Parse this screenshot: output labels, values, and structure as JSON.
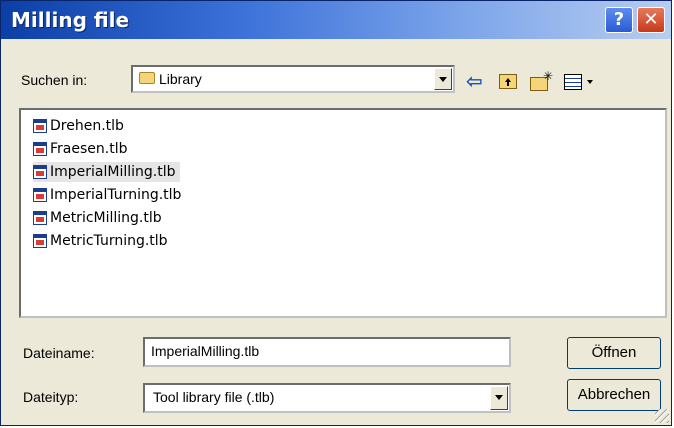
{
  "window": {
    "title": "Milling file"
  },
  "titlebar": {
    "help_glyph": "?",
    "close_glyph": "✕"
  },
  "lookin": {
    "label": "Suchen in:",
    "value": "Library"
  },
  "toolbar": {
    "back_glyph": "⇦"
  },
  "files": [
    {
      "name": "Drehen.tlb",
      "selected": false
    },
    {
      "name": "Fraesen.tlb",
      "selected": false
    },
    {
      "name": "ImperialMilling.tlb",
      "selected": true
    },
    {
      "name": "ImperialTurning.tlb",
      "selected": false
    },
    {
      "name": "MetricMilling.tlb",
      "selected": false
    },
    {
      "name": "MetricTurning.tlb",
      "selected": false
    }
  ],
  "filename": {
    "label": "Dateiname:",
    "value": "ImperialMilling.tlb"
  },
  "filetype": {
    "label": "Dateityp:",
    "value": "Tool library file (.tlb)"
  },
  "buttons": {
    "open": "Öffnen",
    "cancel": "Abbrechen"
  },
  "colors": {
    "titlebar_start": "#0b3fa6",
    "titlebar_end": "#b8cdef",
    "dialog_bg": "#ece9d8",
    "close": "#c7381a"
  }
}
